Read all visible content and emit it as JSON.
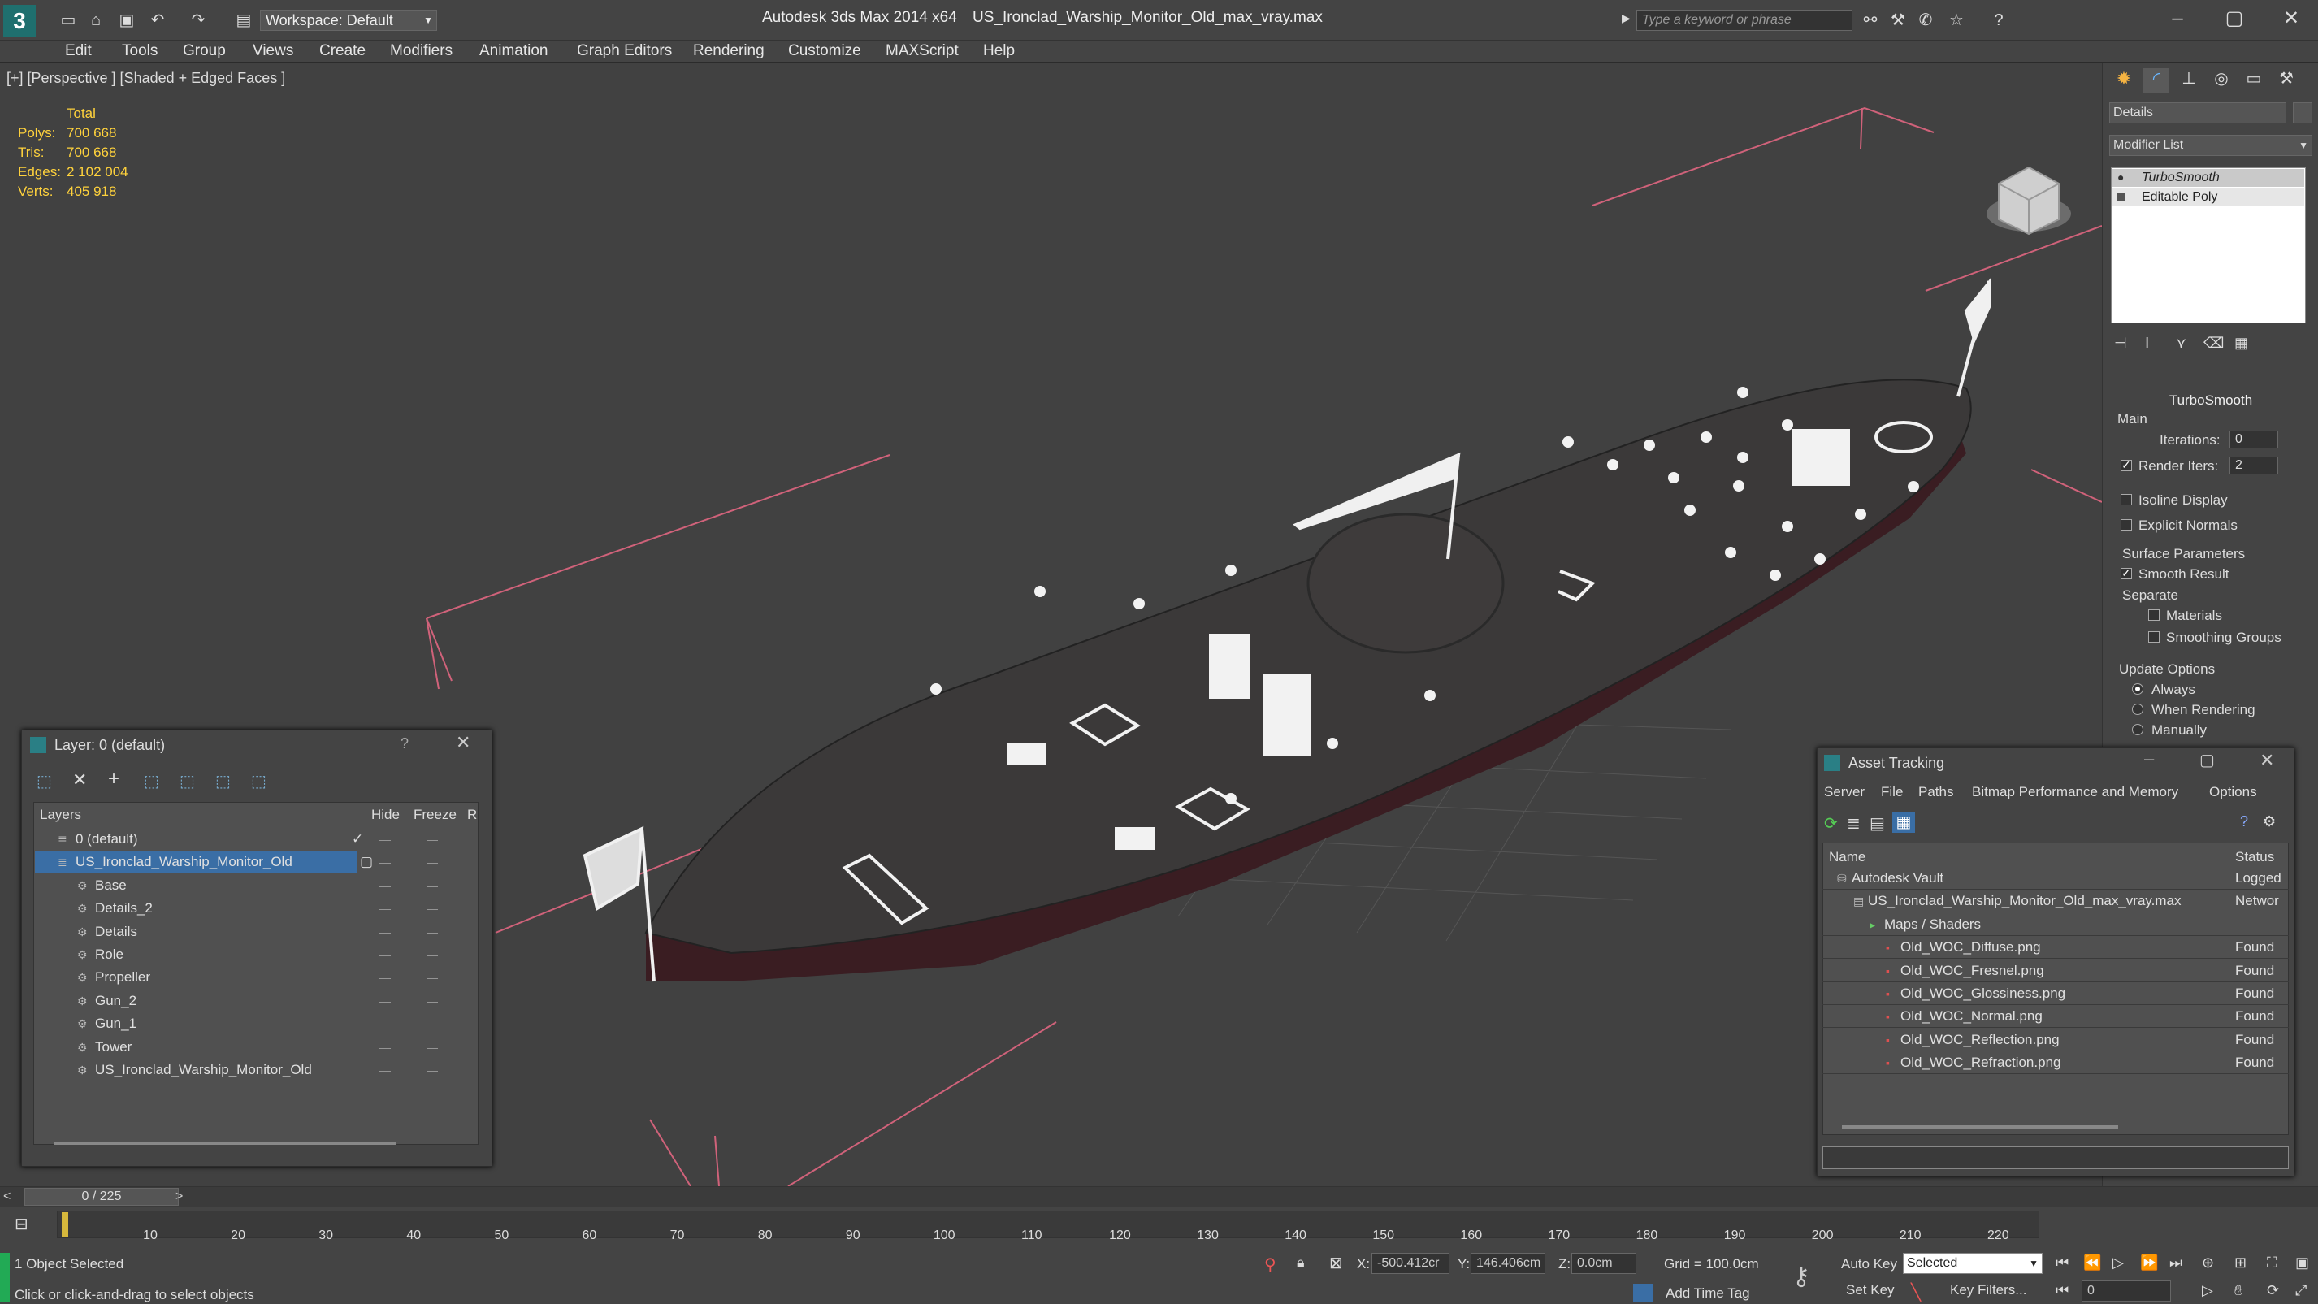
{
  "app": {
    "title": "Autodesk 3ds Max  2014 x64",
    "file": "US_Ironclad_Warship_Monitor_Old_max_vray.max",
    "workspace": "Workspace: Default",
    "search_placeholder": "Type a keyword or phrase"
  },
  "menu": [
    "Edit",
    "Tools",
    "Group",
    "Views",
    "Create",
    "Modifiers",
    "Animation",
    "Graph Editors",
    "Rendering",
    "Customize",
    "MAXScript",
    "Help"
  ],
  "viewport": {
    "label": "[+] [Perspective ] [Shaded + Edged Faces ]",
    "stats": {
      "header": "Total",
      "rows": [
        {
          "label": "Polys:",
          "value": "700 668"
        },
        {
          "label": "Tris:",
          "value": "700 668"
        },
        {
          "label": "Edges:",
          "value": "2 102 004"
        },
        {
          "label": "Verts:",
          "value": "405 918"
        }
      ]
    }
  },
  "command_panel": {
    "name_field": "Details",
    "modifier_list": "Modifier List",
    "stack": [
      "TurboSmooth",
      "Editable Poly"
    ],
    "rollout_title": "TurboSmooth",
    "main_label": "Main",
    "iterations_label": "Iterations:",
    "iterations_value": "0",
    "render_iters_label": "Render Iters:",
    "render_iters_value": "2",
    "isoline": "Isoline Display",
    "explicit_normals": "Explicit Normals",
    "surface_params": "Surface Parameters",
    "smooth_result": "Smooth Result",
    "separate": "Separate",
    "materials": "Materials",
    "smoothing_groups": "Smoothing Groups",
    "update_options": "Update Options",
    "always": "Always",
    "when_rendering": "When Rendering",
    "manually": "Manually"
  },
  "layer_window": {
    "title": "Layer: 0 (default)",
    "help": "?",
    "col_layers": "Layers",
    "col_hide": "Hide",
    "col_freeze": "Freeze",
    "col_r": "R",
    "rows": [
      {
        "name": "0 (default)",
        "indent": 0,
        "selected": false
      },
      {
        "name": "US_Ironclad_Warship_Monitor_Old",
        "indent": 0,
        "selected": true
      },
      {
        "name": "Base",
        "indent": 1,
        "selected": false
      },
      {
        "name": "Details_2",
        "indent": 1,
        "selected": false
      },
      {
        "name": "Details",
        "indent": 1,
        "selected": false
      },
      {
        "name": "Role",
        "indent": 1,
        "selected": false
      },
      {
        "name": "Propeller",
        "indent": 1,
        "selected": false
      },
      {
        "name": "Gun_2",
        "indent": 1,
        "selected": false
      },
      {
        "name": "Gun_1",
        "indent": 1,
        "selected": false
      },
      {
        "name": "Tower",
        "indent": 1,
        "selected": false
      },
      {
        "name": "US_Ironclad_Warship_Monitor_Old",
        "indent": 1,
        "selected": false
      }
    ]
  },
  "asset_window": {
    "title": "Asset Tracking",
    "menu": [
      "Server",
      "File",
      "Paths",
      "Bitmap Performance and Memory",
      "Options"
    ],
    "col_name": "Name",
    "col_status": "Status",
    "rows": [
      {
        "name": "Autodesk Vault",
        "status": "Logged",
        "indent": 0
      },
      {
        "name": "US_Ironclad_Warship_Monitor_Old_max_vray.max",
        "status": "Networ",
        "indent": 1
      },
      {
        "name": "Maps / Shaders",
        "status": "",
        "indent": 2
      },
      {
        "name": "Old_WOC_Diffuse.png",
        "status": "Found",
        "indent": 3
      },
      {
        "name": "Old_WOC_Fresnel.png",
        "status": "Found",
        "indent": 3
      },
      {
        "name": "Old_WOC_Glossiness.png",
        "status": "Found",
        "indent": 3
      },
      {
        "name": "Old_WOC_Normal.png",
        "status": "Found",
        "indent": 3
      },
      {
        "name": "Old_WOC_Reflection.png",
        "status": "Found",
        "indent": 3
      },
      {
        "name": "Old_WOC_Refraction.png",
        "status": "Found",
        "indent": 3
      }
    ]
  },
  "timeline": {
    "frame": "0 / 225",
    "ticks": [
      "10",
      "20",
      "30",
      "40",
      "50",
      "60",
      "70",
      "80",
      "90",
      "100",
      "110",
      "120",
      "130",
      "140",
      "150",
      "160",
      "170",
      "180",
      "190",
      "200",
      "210",
      "220"
    ]
  },
  "status": {
    "selected": "1 Object Selected",
    "prompt": "Click or click-and-drag to select objects",
    "x_label": "X:",
    "x_value": "-500.412cr",
    "y_label": "Y:",
    "y_value": "146.406cm",
    "z_label": "Z:",
    "z_value": "0.0cm",
    "grid": "Grid = 100.0cm",
    "add_time_tag": "Add Time Tag",
    "auto_key": "Auto Key",
    "set_key": "Set Key",
    "key_mode": "Selected",
    "key_filters": "Key Filters...",
    "frame_field": "0"
  }
}
